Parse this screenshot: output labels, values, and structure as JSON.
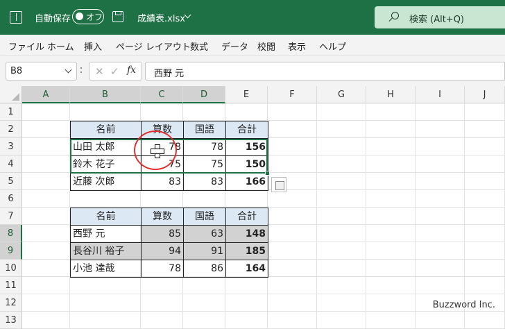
{
  "titlebar": {
    "autosave_label": "自動保存",
    "autosave_state": "オフ",
    "filename": "成績表.xlsx",
    "search_placeholder": "検索 (Alt+Q)"
  },
  "menu": [
    "ファイル",
    "ホーム",
    "挿入",
    "ページ レイアウト",
    "数式",
    "データ",
    "校閲",
    "表示",
    "ヘルプ"
  ],
  "formula_bar": {
    "name_box": "B8",
    "fx": "fx",
    "content": "西野 元"
  },
  "sheet": {
    "columns": [
      "A",
      "B",
      "C",
      "D",
      "E",
      "F",
      "G",
      "H",
      "I",
      "J"
    ],
    "rows": [
      "1",
      "2",
      "3",
      "4",
      "5",
      "6",
      "7",
      "8",
      "9",
      "10",
      "11",
      "12",
      "13"
    ],
    "table1": {
      "header": [
        "名前",
        "算数",
        "国語",
        "合計"
      ],
      "rows": [
        [
          "山田 太郎",
          "78",
          "78",
          "156"
        ],
        [
          "鈴木 花子",
          "75",
          "75",
          "150"
        ],
        [
          "近藤 次郎",
          "83",
          "83",
          "166"
        ]
      ]
    },
    "table2": {
      "header": [
        "名前",
        "算数",
        "国語",
        "合計"
      ],
      "rows": [
        [
          "西野 元",
          "85",
          "63",
          "148"
        ],
        [
          "長谷川 裕子",
          "94",
          "91",
          "185"
        ],
        [
          "小池 達哉",
          "78",
          "86",
          "164"
        ]
      ]
    }
  },
  "watermark": "Buzzword Inc."
}
